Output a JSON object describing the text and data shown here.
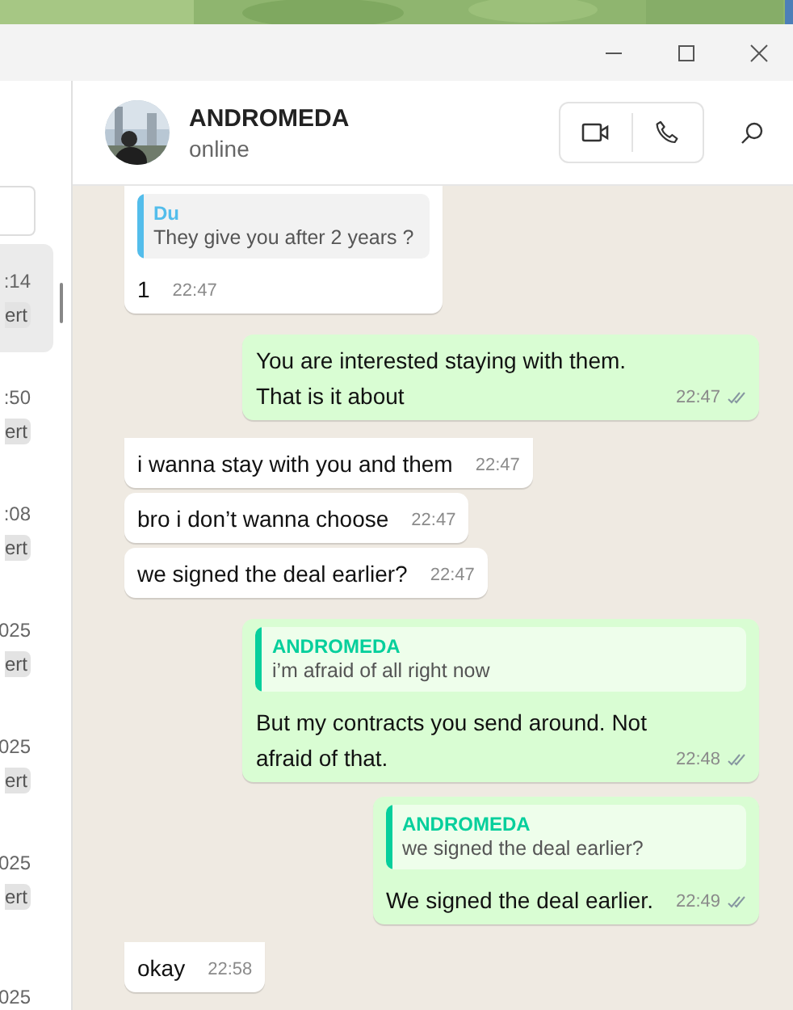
{
  "contact": {
    "name": "ANDROMEDA",
    "status": "online"
  },
  "sidebar": {
    "chats": [
      {
        "time": ":14",
        "badge": "ert",
        "selected": true
      },
      {
        "time": ":50",
        "badge": "ert",
        "selected": false
      },
      {
        "time": ":08",
        "badge": "ert",
        "selected": false
      },
      {
        "time": "025",
        "badge": "ert",
        "selected": false
      },
      {
        "time": "025",
        "badge": "ert",
        "selected": false
      },
      {
        "time": "025",
        "badge": "ert",
        "selected": false
      },
      {
        "time": "025",
        "selected": false
      }
    ]
  },
  "messages": [
    {
      "kind": "incoming",
      "quote": {
        "author": "Du",
        "text": "They give you after 2 years ?",
        "color": "#53bdeb"
      },
      "text": "1",
      "time": "22:47"
    },
    {
      "kind": "outgoing",
      "text": "You are interested staying with them. That is it about",
      "time": "22:47"
    },
    {
      "kind": "incoming",
      "text": "i wanna stay with you and them",
      "time": "22:47"
    },
    {
      "kind": "incoming",
      "text": "bro i don’t wanna choose",
      "time": "22:47"
    },
    {
      "kind": "incoming",
      "text": "we signed the deal earlier?",
      "time": "22:47"
    },
    {
      "kind": "outgoing",
      "quote": {
        "author": "ANDROMEDA",
        "text": "i’m afraid of all right now",
        "color": "#06cf9c"
      },
      "text": "But my contracts you send around. Not afraid of that.",
      "time": "22:48"
    },
    {
      "kind": "outgoing",
      "quote": {
        "author": "ANDROMEDA",
        "text": "we signed the deal earlier?",
        "color": "#06cf9c"
      },
      "text": "We signed the deal earlier.",
      "time": "22:49"
    },
    {
      "kind": "incoming",
      "text": "okay",
      "time": "22:58"
    }
  ]
}
